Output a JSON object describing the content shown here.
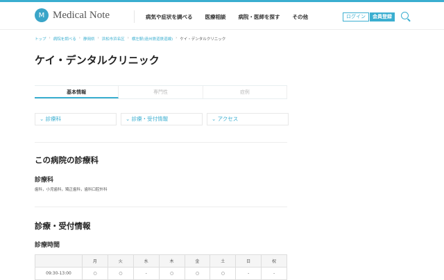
{
  "header": {
    "logo": "Medical Note",
    "nav": [
      "病気や症状を調べる",
      "医療相談",
      "病院・医師を探す",
      "その他"
    ],
    "login": "ログイン",
    "register": "会員登録"
  },
  "breadcrumb": [
    "トップ",
    "病院を調べる",
    "静岡県",
    "浜松市浜名区",
    "横左駅(遠州鉄道鉄道線)",
    "ケイ・デンタルクリニック"
  ],
  "title": "ケイ・デンタルクリニック",
  "tabs": [
    "基本情報",
    "専門性",
    "症例"
  ],
  "anchors": [
    "診療科",
    "診療・受付情報",
    "アクセス"
  ],
  "section1": {
    "title": "この病院の診療科",
    "sub": "診療科",
    "departments": "歯科，小児歯科，矯正歯科，歯科口腔外科"
  },
  "section2": {
    "title": "診療・受付情報",
    "sub": "診療時間"
  },
  "schedule": {
    "days": [
      "月",
      "火",
      "水",
      "木",
      "金",
      "土",
      "日",
      "祝"
    ],
    "rows": [
      {
        "time": "09:30-13:00",
        "marks": [
          "○",
          "○",
          "-",
          "○",
          "○",
          "○",
          "-",
          "-"
        ]
      }
    ]
  }
}
